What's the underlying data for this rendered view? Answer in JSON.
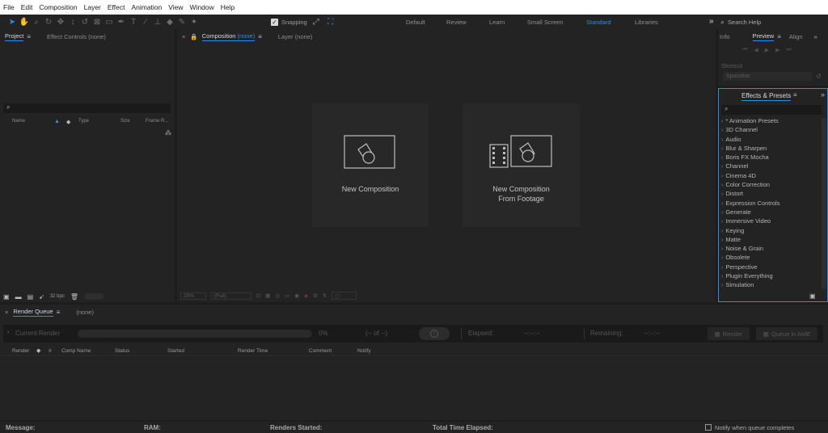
{
  "menu": [
    "File",
    "Edit",
    "Composition",
    "Layer",
    "Effect",
    "Animation",
    "View",
    "Window",
    "Help"
  ],
  "toolbar": {
    "snapping_label": "Snapping",
    "workspaces": [
      "Default",
      "Review",
      "Learn",
      "Small Screen",
      "Standard",
      "Libraries"
    ],
    "active_workspace": "Standard",
    "more_glyph": "»",
    "search_help_placeholder": "Search Help"
  },
  "project_panel": {
    "tab_project": "Project",
    "tab_effect_controls": "Effect Controls (none)",
    "columns": [
      "Name",
      "Type",
      "Size",
      "Frame R..."
    ],
    "bpc": "32 bpc"
  },
  "composition_panel": {
    "tab_composition": "Composition",
    "tab_composition_suffix": "(none)",
    "tab_layer": "Layer (none)",
    "new_composition": "New Composition",
    "new_from_footage_line1": "New Composition",
    "new_from_footage_line2": "From Footage",
    "zoom": "25%",
    "resolution": "(Full)"
  },
  "right_top": {
    "tab_info": "Info",
    "tab_preview": "Preview",
    "tab_align": "Align",
    "shortcut_label": "Shortcut",
    "shortcut_value": "Spacebar"
  },
  "effects_presets": {
    "title": "Effects & Presets",
    "items": [
      "* Animation Presets",
      "3D Channel",
      "Audio",
      "Blur & Sharpen",
      "Boris FX Mocha",
      "Channel",
      "Cinema 4D",
      "Color Correction",
      "Distort",
      "Expression Controls",
      "Generate",
      "Immersive Video",
      "Keying",
      "Matte",
      "Noise & Grain",
      "Obsolete",
      "Perspective",
      "Plugin Everything",
      "Simulation"
    ]
  },
  "render_queue": {
    "tab": "Render Queue",
    "tab_none": "(none)",
    "current_render": "Current Render",
    "percent": "0%",
    "frames": "(-- of --)",
    "elapsed_label": "Elapsed:",
    "elapsed_value": "--:--:--",
    "remaining_label": "Remaining:",
    "remaining_value": "--:--:--",
    "render_button": "Render",
    "queue_ame_button": "Queue in AME",
    "columns": [
      "Render",
      "#",
      "Comp Name",
      "Status",
      "Started",
      "Render Time",
      "Comment",
      "Notify"
    ]
  },
  "status_bar": {
    "message": "Message:",
    "ram": "RAM:",
    "renders_started": "Renders Started:",
    "total_time": "Total Time Elapsed:",
    "notify": "Notify when queue completes"
  },
  "colors": {
    "accent": "#2d8ceb",
    "panel_bg": "#232323",
    "app_bg": "#1d1d1d"
  }
}
